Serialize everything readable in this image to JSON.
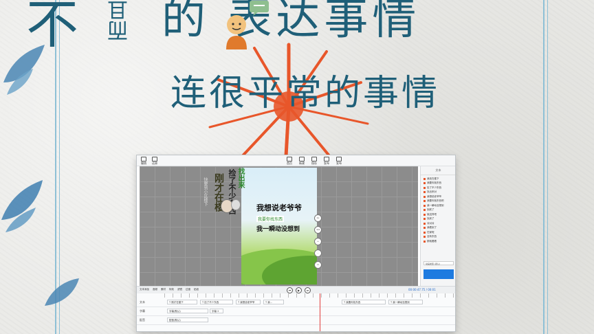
{
  "header": {
    "left_big": "不",
    "left_vert": "而且",
    "title": "的  表达事情",
    "subtitle": "连很平常的事情"
  },
  "colors": {
    "title": "#1f5f78",
    "burst": "#e8562a",
    "frame": "#8ec0d6",
    "accent_blue": "#1e7be0"
  },
  "editor": {
    "toolbar_left": [
      {
        "label": "撤销",
        "icon": "undo-icon"
      },
      {
        "label": "还原",
        "icon": "redo-icon"
      }
    ],
    "toolbar_center": [
      {
        "label": "首页",
        "icon": "home-icon"
      },
      {
        "label": "新建",
        "icon": "new-icon"
      },
      {
        "label": "保存",
        "icon": "save-icon"
      },
      {
        "label": "发布",
        "icon": "publish-icon"
      },
      {
        "label": "发布",
        "icon": "export-icon"
      }
    ],
    "canvas": {
      "main_line": "我想说老爷爷",
      "tag_line": "我要你找东西",
      "third_line": "我一瞬动没想到",
      "green_vertical": "找出来",
      "left_vertical_big": "刚才在楼",
      "left_vertical_small": "快要到小区楼下",
      "mid_vertical": "捡了不少东西"
    },
    "side_tools": [
      "1x",
      "1/4",
      "+",
      "–",
      "⊙"
    ],
    "right_panel": {
      "header": "文本",
      "items": [
        "我还在楼下",
        "我要你找东西",
        "捡了不少东西",
        "找出来对",
        "我想说老爷爷",
        "我要你找东西吧",
        "我一瞬动没想到",
        "到底了",
        "就这样吧",
        "找到了",
        "对对对",
        "我看到了",
        "在家呢",
        "没有东西",
        "那就看看"
      ],
      "select_label": "动画类型 (默认)"
    },
    "controls": {
      "left_items": [
        "文本添加",
        "音频",
        "素材",
        "特效",
        "滤镜",
        "过渡",
        "贴纸"
      ],
      "play_buttons": [
        "⏮",
        "▶",
        "⏭"
      ],
      "time": "00:00:47.75 / 00:01"
    },
    "timeline": {
      "tracks": [
        {
          "label": "文本",
          "clips": [
            "T 刚才在楼下",
            "T 捡了不少东西",
            "T 我想说老爷爷",
            "T 我...",
            "T 我要你找东西",
            "T 我一瞬动没想到"
          ]
        },
        {
          "label": "字幕",
          "clips": [
            "字幕(默认)",
            "字幕 2"
          ]
        },
        {
          "label": "配音",
          "clips": [
            "配音(默认)"
          ]
        }
      ]
    }
  }
}
